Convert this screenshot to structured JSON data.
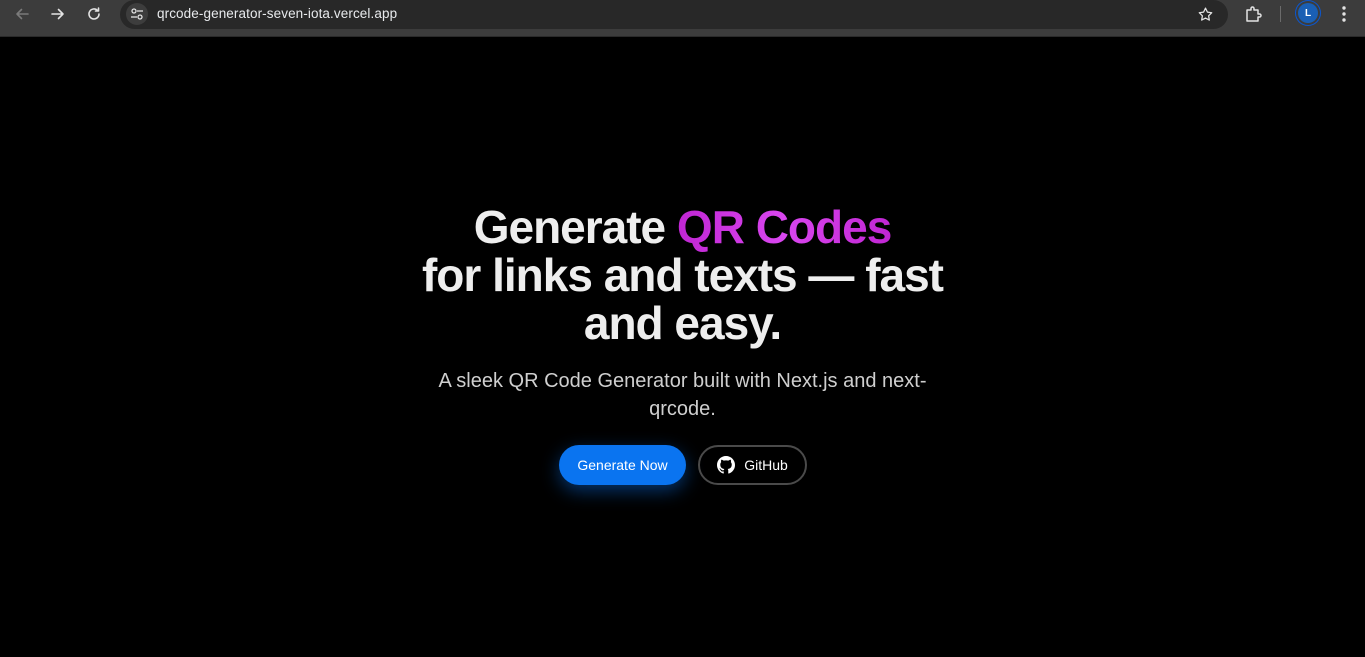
{
  "browser": {
    "url": "qrcode-generator-seven-iota.vercel.app",
    "profile_initial": "L",
    "icons": {
      "back": "back-arrow-icon",
      "forward": "forward-arrow-icon",
      "reload": "reload-icon",
      "site_info": "tune-icon",
      "bookmark": "star-icon",
      "extensions": "puzzle-icon",
      "menu": "kebab-menu-icon"
    }
  },
  "hero": {
    "headline_pre": "Generate ",
    "headline_accent": "QR Codes",
    "headline_post": "for links and texts — fast and easy.",
    "subtitle": "A sleek QR Code Generator built with Next.js and next-qrcode.",
    "primary_button": "Generate Now",
    "secondary_button": "GitHub",
    "secondary_icon": "github-icon"
  },
  "colors": {
    "accent": "#d946ef",
    "primary": "#0a74f0",
    "background": "#000000"
  }
}
